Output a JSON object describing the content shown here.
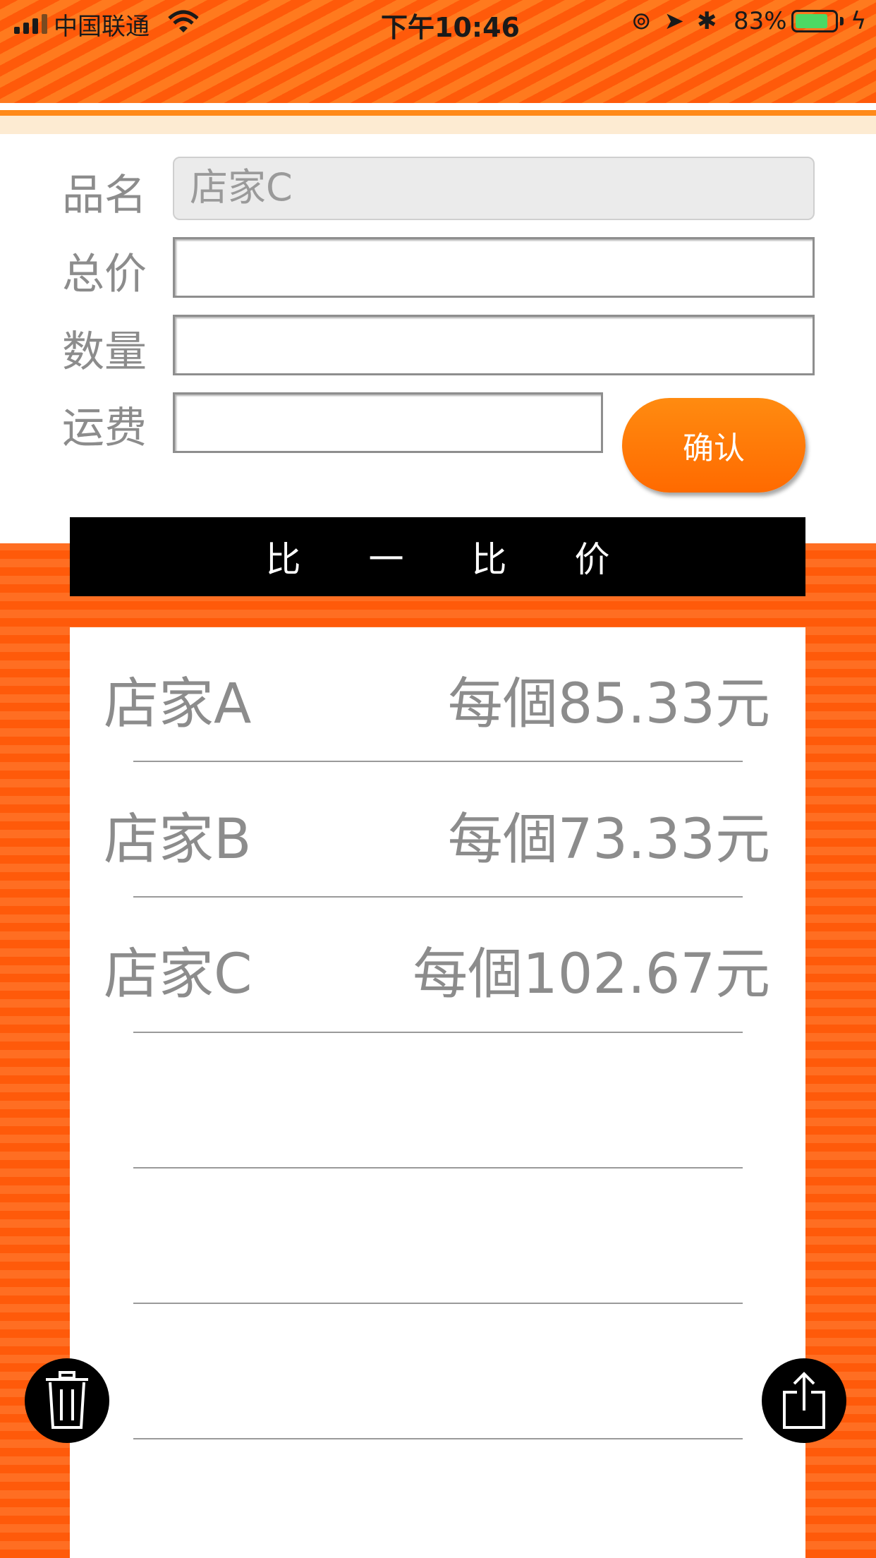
{
  "status_bar": {
    "carrier": "中国联通",
    "time": "下午10:46",
    "battery_percent": "83%",
    "battery_level": 0.83
  },
  "form": {
    "name_label": "品名",
    "name_value": "店家C",
    "total_label": "总价",
    "total_value": "",
    "quantity_label": "数量",
    "quantity_value": "",
    "shipping_label": "运费",
    "shipping_value": "",
    "confirm_label": "确认"
  },
  "compare": {
    "title_chars": [
      "比",
      "一",
      "比",
      "价"
    ],
    "rows": [
      {
        "name": "店家A",
        "price": "每個85.33元"
      },
      {
        "name": "店家B",
        "price": "每個73.33元"
      },
      {
        "name": "店家C",
        "price": "每個102.67元"
      },
      {
        "name": "",
        "price": ""
      },
      {
        "name": "",
        "price": ""
      },
      {
        "name": "",
        "price": ""
      }
    ]
  },
  "icons": {
    "delete": "trash-icon",
    "share": "share-icon"
  },
  "colors": {
    "accent": "#ff5a0a",
    "button": "#ff7a00"
  }
}
